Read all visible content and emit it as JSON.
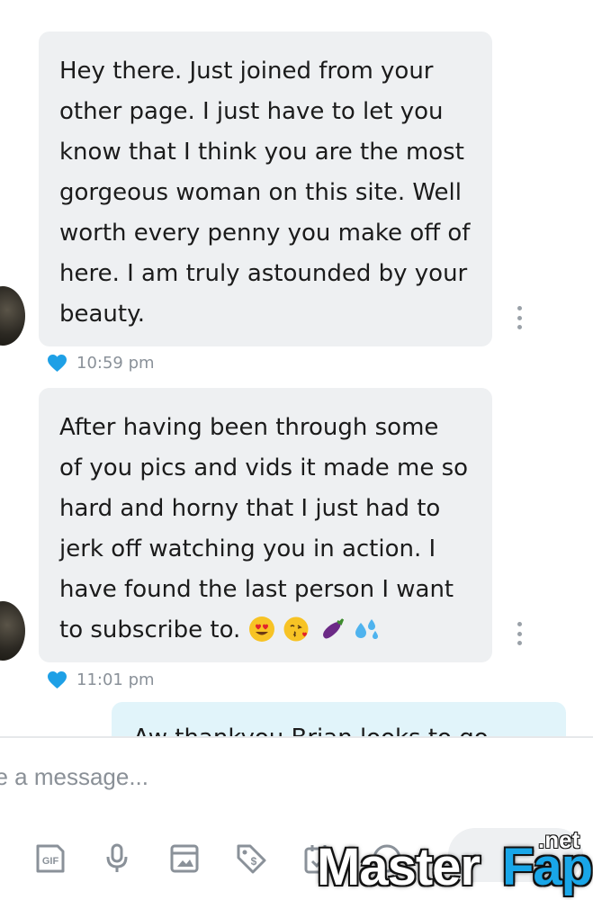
{
  "messages": [
    {
      "direction": "incoming",
      "lines": [
        "Hey there. Just joined from your",
        "other page. I just have to let you",
        "know that I think you are the most",
        "gorgeous woman on this site. Well",
        "worth every penny you make off of",
        "here. I am truly astounded by your",
        "beauty."
      ],
      "time": "10:59 pm",
      "liked": true
    },
    {
      "direction": "incoming",
      "lines": [
        "After having been through some",
        "of you pics and vids it made me so",
        "hard and horny that I just had to",
        "jerk off watching you in action. I",
        "have found the last person I want",
        "to subscribe to."
      ],
      "emojis": [
        "heart-eyes-emoji",
        "kissing-heart-emoji",
        "eggplant-emoji",
        "sweat-droplets-emoji"
      ],
      "time": "11:01 pm",
      "liked": true
    },
    {
      "direction": "outgoing",
      "text": "Aw thankyou Brian looks to go"
    }
  ],
  "composer": {
    "placeholder": "pe a message..."
  },
  "toolbar": {
    "icons": [
      "gif-icon",
      "microphone-icon",
      "media-icon",
      "price-tag-icon",
      "calendar-icon",
      "question-icon"
    ]
  },
  "watermark": {
    "master": "Master",
    "fap": "Fap",
    "net": ".net"
  },
  "colors": {
    "incoming_bubble": "#eef0f2",
    "outgoing_bubble": "#e1f4fa",
    "accent_blue": "#1ea0e6",
    "timestamp": "#8a9199",
    "icon_gray": "#8a9199"
  }
}
